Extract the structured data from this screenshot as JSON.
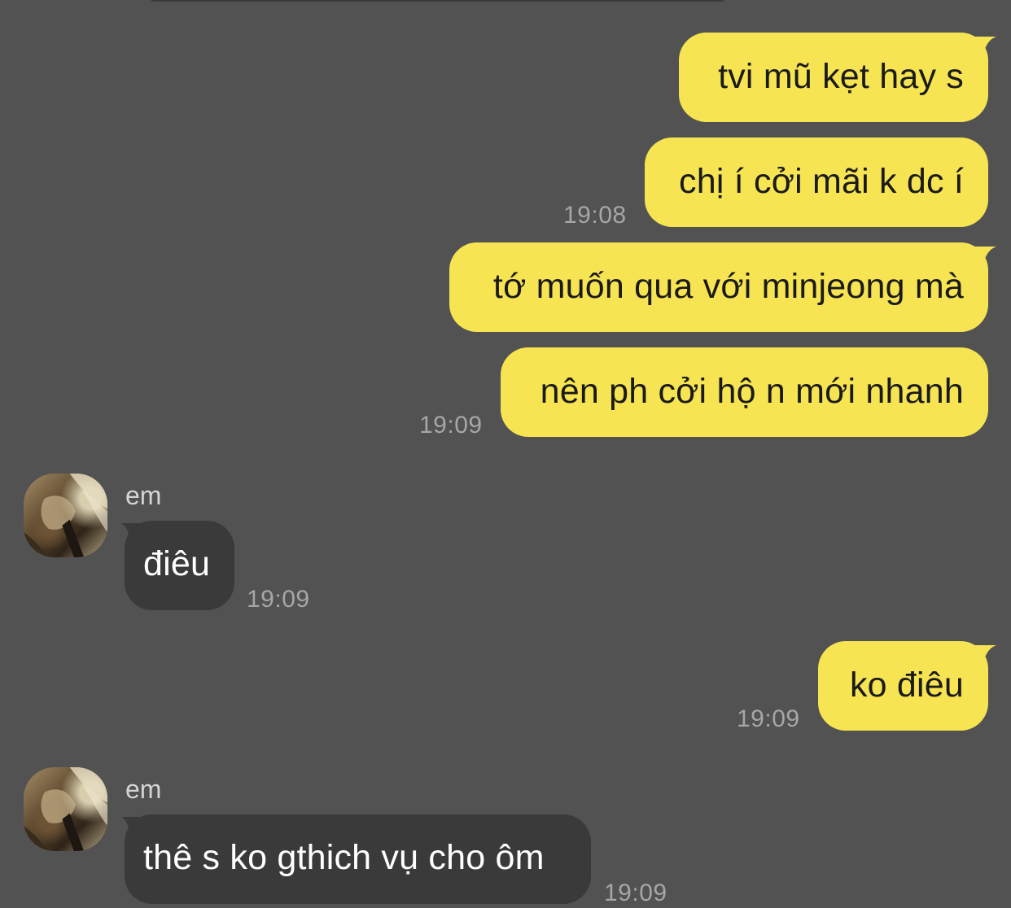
{
  "colors": {
    "background": "#525252",
    "outgoing_bubble": "#f7e452",
    "incoming_bubble": "#3a3a3a",
    "timestamp": "#a6a6a6"
  },
  "messages": {
    "m1": {
      "text": "tvi mũ kẹt hay s"
    },
    "m2": {
      "text": "chị í cởi mãi k dc í",
      "time": "19:08"
    },
    "m3": {
      "text": "tớ muốn qua với minjeong mà"
    },
    "m4": {
      "text": "nên ph cởi hộ n mới nhanh",
      "time": "19:09"
    },
    "m5": {
      "sender": "em",
      "text": "điêu",
      "time": "19:09",
      "avatar_icon": "profile-photo"
    },
    "m6": {
      "text": "ko điêu",
      "time": "19:09"
    },
    "m7": {
      "sender": "em",
      "text": "thê s ko gthich vụ cho ôm",
      "time": "19:09",
      "avatar_icon": "profile-photo"
    }
  }
}
